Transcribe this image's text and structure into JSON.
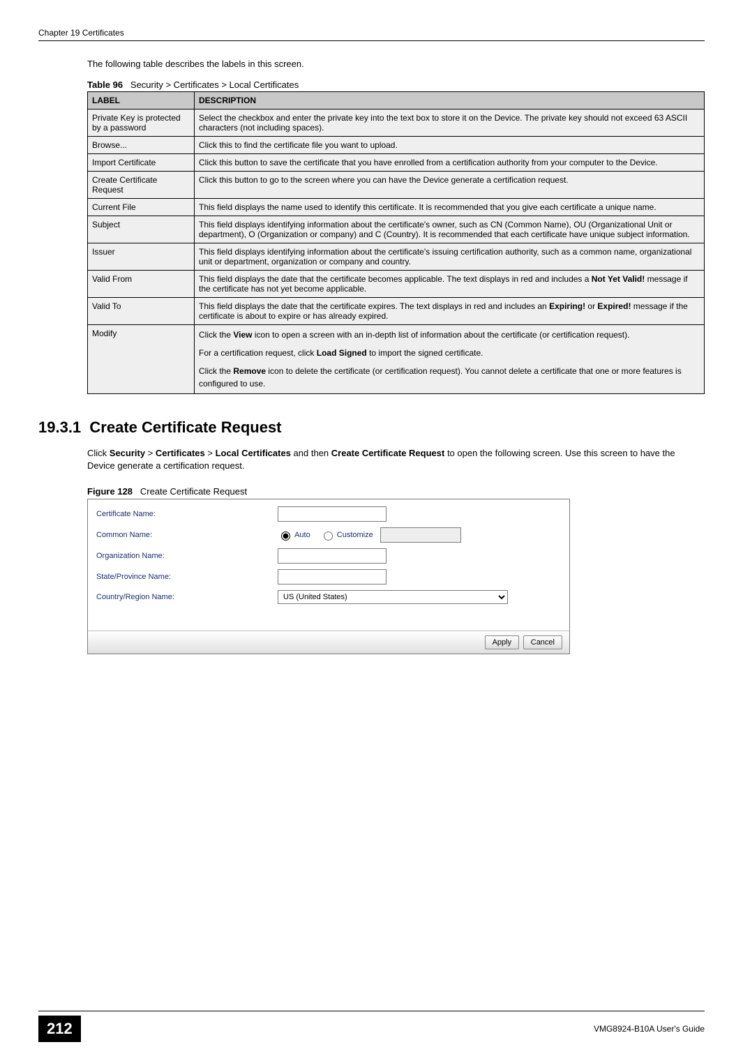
{
  "header": {
    "chapter": "Chapter 19 Certificates"
  },
  "intro": "The following table describes the labels in this screen.",
  "table": {
    "caption_prefix": "Table 96",
    "caption": "Security > Certificates > Local Certificates",
    "head_label": "LABEL",
    "head_desc": "DESCRIPTION",
    "rows": [
      {
        "label": "Private Key is protected by a password",
        "desc": "Select the checkbox and enter the private key into the text box to store it on the Device. The private key should not exceed 63 ASCII characters (not including spaces)."
      },
      {
        "label": "Browse...",
        "desc": "Click this to find the certificate file you want to upload."
      },
      {
        "label": "Import Certificate",
        "desc": "Click this button to save the certificate that you have enrolled from a certification authority from your computer to the Device."
      },
      {
        "label": "Create Certificate Request",
        "desc": "Click this button to go to the screen where you can have the Device generate a certification request."
      },
      {
        "label": "Current File",
        "desc": "This field displays the name used to identify this certificate. It is recommended that you give each certificate a unique name."
      },
      {
        "label": "Subject",
        "desc": "This field displays identifying information about the certificate's owner, such as CN (Common Name), OU (Organizational Unit or department), O (Organization or company) and C (Country). It is recommended that each certificate have unique subject information."
      },
      {
        "label": "Issuer",
        "desc": "This field displays identifying information about the certificate's issuing certification authority, such as a common name, organizational unit or department, organization or company and country."
      },
      {
        "label": "Valid From",
        "desc_pre": "This field displays the date that the certificate becomes applicable. The text displays in red and includes a ",
        "desc_bold": "Not Yet Valid!",
        "desc_post": " message if the certificate has not yet become applicable."
      },
      {
        "label": "Valid To",
        "desc_pre": "This field displays the date that the certificate expires. The text displays in red and includes an ",
        "desc_bold": "Expiring!",
        "desc_mid": " or ",
        "desc_bold2": "Expired!",
        "desc_post": " message if the certificate is about to expire or has already expired."
      },
      {
        "label": "Modify",
        "p1_pre": "Click the ",
        "p1_bold": "View",
        "p1_post": " icon to open a screen with an in-depth list of information about the certificate (or certification request).",
        "p2_pre": "For a certification request, click ",
        "p2_bold": "Load Signed",
        "p2_post": " to import the signed certificate.",
        "p3_pre": "Click the ",
        "p3_bold": "Remove",
        "p3_post": " icon to delete the certificate (or certification request). You cannot delete a certificate that one or more features is configured to use."
      }
    ]
  },
  "section": {
    "number": "19.3.1",
    "title": "Create Certificate Request",
    "body_pre": "Click ",
    "b1": "Security",
    "sep1": " > ",
    "b2": "Certificates",
    "sep2": " > ",
    "b3": "Local Certificates",
    "mid": " and then ",
    "b4": "Create Certificate Request",
    "body_post": " to open the following screen. Use this screen to have the Device generate a certification request."
  },
  "figure": {
    "caption_prefix": "Figure 128",
    "caption": "Create Certificate Request",
    "form": {
      "cert_name_label": "Certificate Name:",
      "common_name_label": "Common Name:",
      "auto_label": "Auto",
      "customize_label": "Customize",
      "org_name_label": "Organization Name:",
      "state_label": "State/Province Name:",
      "country_label": "Country/Region Name:",
      "country_value": "US (United States)",
      "apply": "Apply",
      "cancel": "Cancel"
    }
  },
  "footer": {
    "page": "212",
    "guide": "VMG8924-B10A User's Guide"
  }
}
